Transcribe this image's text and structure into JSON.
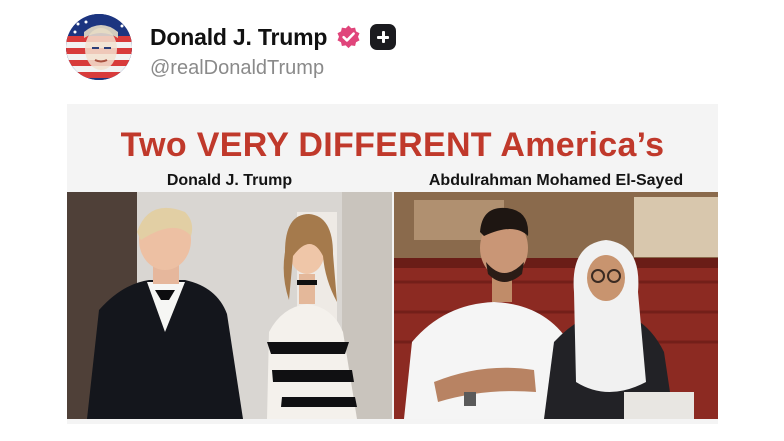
{
  "post": {
    "display_name": "Donald J. Trump",
    "handle": "@realDonaldTrump",
    "avatar_icon": "profile-avatar-flag-portrait",
    "verified_icon": "verified-badge-icon",
    "verified_color": "#e0457b",
    "plus_icon": "plus-icon"
  },
  "image": {
    "headline": "Two VERY DIFFERENT America’s",
    "headline_color": "#c0392b",
    "left_caption": "Donald J. Trump",
    "right_caption": "Abdulrahman Mohamed El-Sayed"
  }
}
